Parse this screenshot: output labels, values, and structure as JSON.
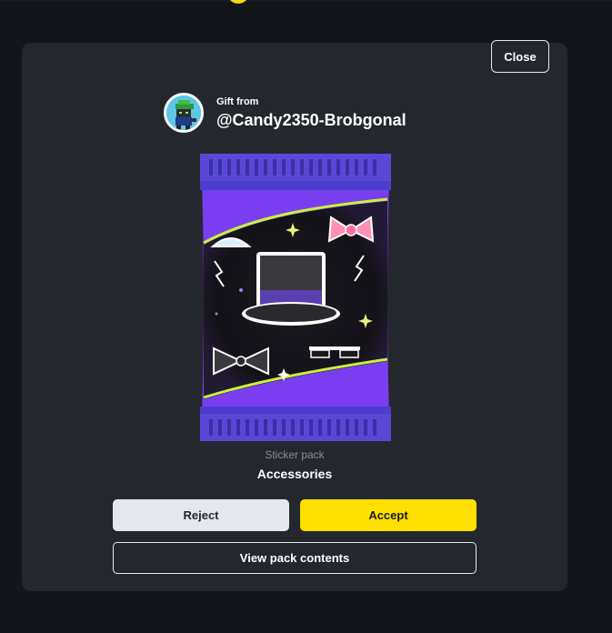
{
  "modal": {
    "close_label": "Close",
    "gift_from_label": "Gift from",
    "sender_name": "@Candy2350-Brobgonal",
    "pack_type": "Sticker pack",
    "pack_name": "Accessories",
    "reject_label": "Reject",
    "accept_label": "Accept",
    "view_contents_label": "View pack contents"
  },
  "colors": {
    "background": "#14151a",
    "modal": "#25272e",
    "accent": "#ffe000",
    "pack_purple": "#7a3ef0",
    "pack_stripe": "#5440d8"
  },
  "icons": {
    "avatar": "robot-avatar-icon",
    "pack": "sticker-pack-illustration"
  }
}
